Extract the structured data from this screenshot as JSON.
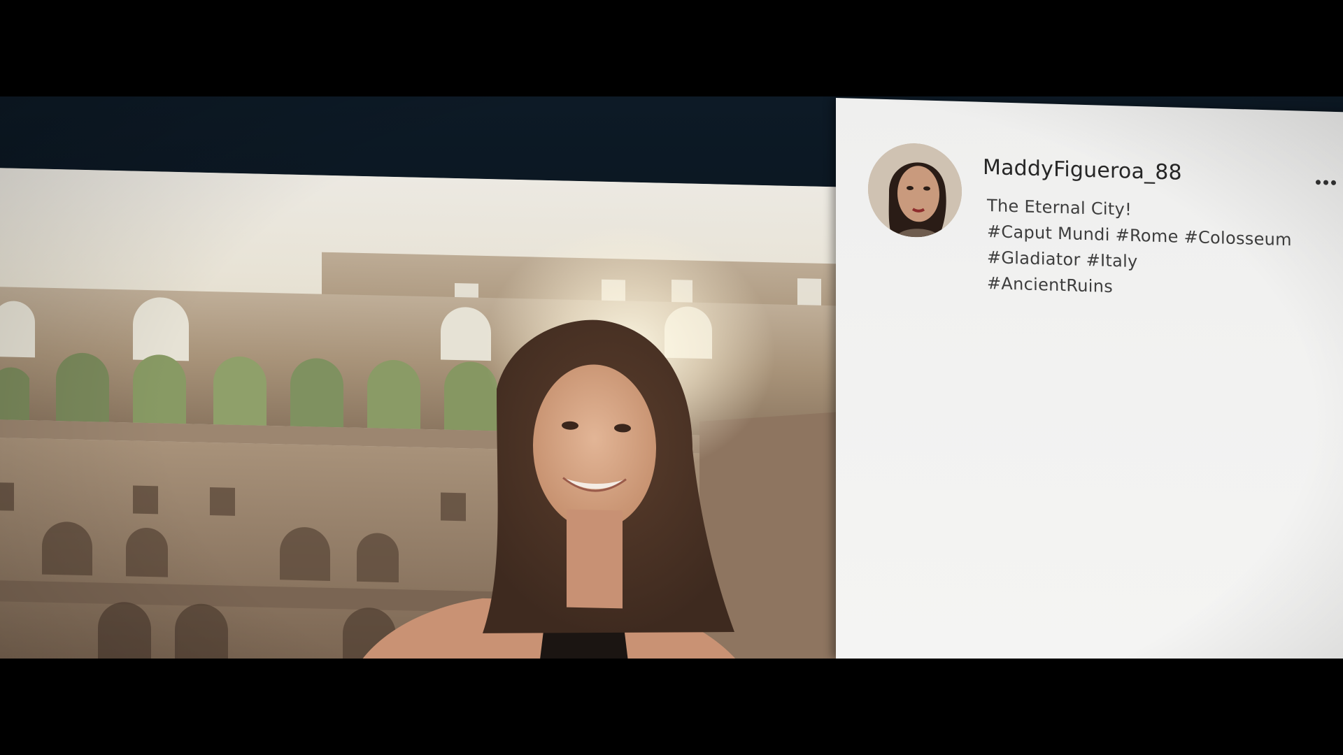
{
  "post": {
    "username": "MaddyFigueroa_88",
    "caption_lines": [
      "The Eternal City!",
      "#Caput Mundi #Rome #Colosseum",
      "#Gladiator #Italy",
      "#AncientRuins"
    ],
    "photo_description_icon": "photo",
    "avatar_icon": "profile-photo",
    "more_icon": "ellipsis-icon"
  },
  "colors": {
    "panel_bg": "#f2f2f1",
    "username_text": "#262626",
    "caption_text": "#3d3d3d",
    "backdrop": "#0a141e"
  }
}
